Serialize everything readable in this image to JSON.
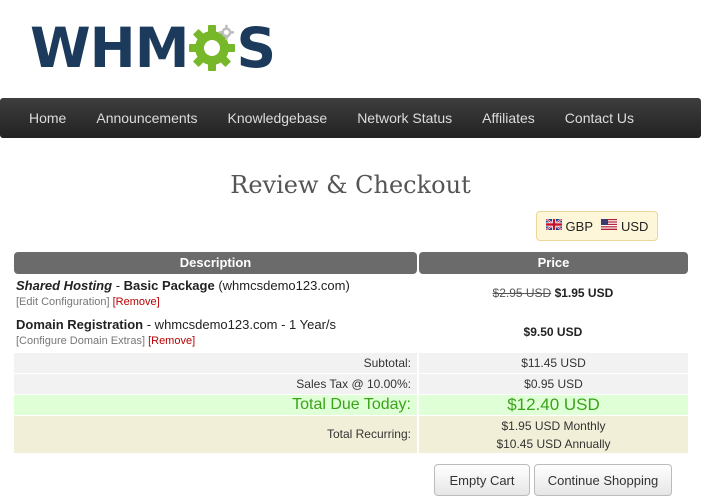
{
  "logo": {
    "text_left": "WHM",
    "text_right": "S",
    "alt": "WHMCS"
  },
  "nav": {
    "items": [
      "Home",
      "Announcements",
      "Knowledgebase",
      "Network Status",
      "Affiliates",
      "Contact Us"
    ]
  },
  "page": {
    "title": "Review & Checkout"
  },
  "currency": {
    "options": [
      {
        "code": "GBP",
        "flag": "uk-flag-icon"
      },
      {
        "code": "USD",
        "flag": "us-flag-icon"
      }
    ]
  },
  "cart": {
    "headers": {
      "description": "Description",
      "price": "Price"
    },
    "items": [
      {
        "title_italic": "Shared Hosting",
        "title_sep": " - ",
        "title_bold": "Basic Package",
        "title_extra": " (whmcsdemo123.com)",
        "link1": "[Edit Configuration]",
        "link2": "[Remove]",
        "old_price": "$2.95 USD",
        "price": "$1.95 USD"
      },
      {
        "title_bold": "Domain Registration",
        "title_extra": " - whmcsdemo123.com - 1 Year/s",
        "link1": "[Configure Domain Extras]",
        "link2": "[Remove]",
        "price": "$9.50 USD"
      }
    ],
    "subtotal_label": "Subtotal:",
    "subtotal_value": "$11.45 USD",
    "tax_label": "Sales Tax @ 10.00%:",
    "tax_value": "$0.95 USD",
    "total_label": "Total Due Today:",
    "total_value": "$12.40 USD",
    "recurring_label": "Total Recurring:",
    "recurring_monthly": "$1.95 USD Monthly",
    "recurring_annually": "$10.45 USD Annually"
  },
  "buttons": {
    "empty": "Empty Cart",
    "continue": "Continue Shopping"
  },
  "colors": {
    "logo_blue": "#1b3a5c",
    "logo_green": "#77b82a",
    "total_green": "#3aa31a"
  }
}
